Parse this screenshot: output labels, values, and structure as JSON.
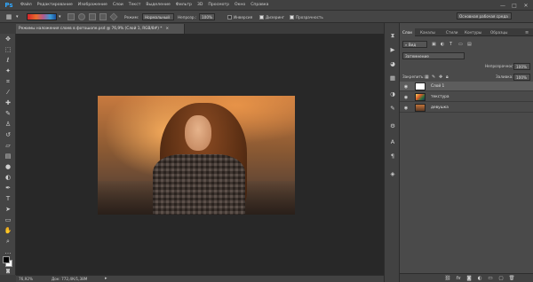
{
  "app": {
    "logo": "Ps"
  },
  "menu": [
    "Файл",
    "Редактирование",
    "Изображение",
    "Слои",
    "Текст",
    "Выделение",
    "Фильтр",
    "3D",
    "Просмотр",
    "Окно",
    "Справка"
  ],
  "window_controls": [
    "—",
    "□",
    "✕"
  ],
  "options_bar": {
    "mode_label": "Режим:",
    "mode_value": "Нормальный",
    "opacity_label": "Непрозр.:",
    "opacity_value": "100%",
    "inverse_label": "Инверсия",
    "dither_label": "Дизеринг",
    "transparency_label": "Прозрачность",
    "workspace": "Основная рабочая среда"
  },
  "document": {
    "tab_title": "Режимы наложения слоев в фотошопе.psd @ 76,9% (Слой 1, RGB/8#) *",
    "close": "×"
  },
  "status": {
    "zoom": "76,92%",
    "doc_size": "Док: 772,4К/1,38М",
    "arrow": "▸"
  },
  "layers_panel": {
    "tabs": [
      "Слои",
      "Каналы",
      "Стили",
      "Контуры",
      "Образцы"
    ],
    "active_tab": "Слои",
    "kind_filter": "Вид",
    "blend_mode": "Затемнение",
    "opacity_label": "Непрозрачность:",
    "opacity_value": "100%",
    "lock_label": "Закрепить:",
    "fill_label": "Заливка:",
    "fill_value": "100%",
    "layers": [
      {
        "name": "Слой 1",
        "selected": true
      },
      {
        "name": "текстура",
        "selected": false
      },
      {
        "name": "девушка",
        "selected": false
      }
    ]
  },
  "icons": {
    "tools": [
      "move-icon",
      "marquee-icon",
      "lasso-icon",
      "magic-wand-icon",
      "crop-icon",
      "eyedropper-icon",
      "healing-icon",
      "brush-icon",
      "clone-stamp-icon",
      "history-brush-icon",
      "eraser-icon",
      "gradient-icon",
      "blur-icon",
      "dodge-icon",
      "pen-icon",
      "type-icon",
      "path-selection-icon",
      "shape-icon",
      "hand-icon",
      "zoom-icon"
    ],
    "panel_bottom": [
      "link-icon",
      "fx-icon",
      "mask-icon",
      "adjustment-icon",
      "folder-icon",
      "new-layer-icon",
      "trash-icon"
    ]
  },
  "colors": {
    "accent": "#31a8ff",
    "canvas_bg": "#282828",
    "panel_bg": "#4a4a4a"
  }
}
